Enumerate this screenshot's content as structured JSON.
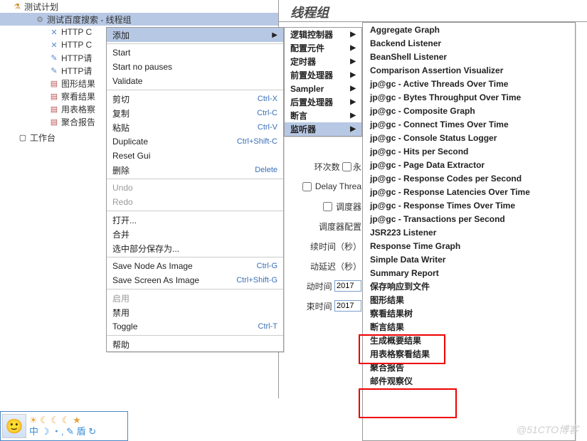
{
  "tree": {
    "root": "测试计划",
    "children": [
      "测试百度搜索 - 线程组",
      "HTTP C",
      "HTTP C",
      "HTTP请",
      "HTTP请",
      "图形结果",
      "察看结果",
      "用表格察",
      "聚合报告"
    ],
    "workbench": "工作台"
  },
  "panel_title": "线程组",
  "menu1": {
    "add": "添加",
    "start": "Start",
    "start_no_pauses": "Start no pauses",
    "validate": "Validate",
    "cut": "剪切",
    "cut_k": "Ctrl-X",
    "copy": "复制",
    "copy_k": "Ctrl-C",
    "paste": "粘贴",
    "paste_k": "Ctrl-V",
    "duplicate": "Duplicate",
    "dup_k": "Ctrl+Shift-C",
    "reset": "Reset Gui",
    "delete": "删除",
    "delete_k": "Delete",
    "undo": "Undo",
    "redo": "Redo",
    "open": "打开...",
    "merge": "合并",
    "save_sel": "选中部分保存为...",
    "save_node": "Save Node As Image",
    "save_node_k": "Ctrl-G",
    "save_screen": "Save Screen As Image",
    "save_screen_k": "Ctrl+Shift-G",
    "enable": "启用",
    "disable": "禁用",
    "toggle": "Toggle",
    "toggle_k": "Ctrl-T",
    "help": "帮助"
  },
  "menu2": {
    "logic": "逻辑控制器",
    "config": "配置元件",
    "timer": "定时器",
    "pre": "前置处理器",
    "sampler": "Sampler",
    "post": "后置处理器",
    "assert": "断言",
    "listener": "监听器"
  },
  "menu3": [
    "Aggregate Graph",
    "Backend Listener",
    "BeanShell Listener",
    "Comparison Assertion Visualizer",
    "jp@gc - Active Threads Over Time",
    "jp@gc - Bytes Throughput Over Time",
    "jp@gc - Composite Graph",
    "jp@gc - Connect Times Over Time",
    "jp@gc - Console Status Logger",
    "jp@gc - Hits per Second",
    "jp@gc - Page Data Extractor",
    "jp@gc - Response Codes per Second",
    "jp@gc - Response Latencies Over Time",
    "jp@gc - Response Times Over Time",
    "jp@gc - Transactions per Second",
    "JSR223 Listener",
    "Response Time Graph",
    "Simple Data Writer",
    "Summary Report",
    "保存响应到文件",
    "图形结果",
    "察看结果树",
    "断言结果",
    "生成概要结果",
    "用表格察看结果",
    "聚合报告",
    "邮件观察仪"
  ],
  "bg": {
    "loops_label": "环次数",
    "forever": "永",
    "delay_thread": "Delay Threa",
    "scheduler": "调度器",
    "sched_cfg": "调度器配置",
    "duration": "续时间（秒）",
    "delay": "动延迟（秒）",
    "start_time": "动时间",
    "end_time": "束时间",
    "time_val": "2017"
  },
  "bottom_icons": {
    "row1": "☀ ☾ ☾ ☾ ★",
    "row2": "中 ☽ ・, ✎ 盾 ↻"
  },
  "watermark": "@51CTO博客"
}
